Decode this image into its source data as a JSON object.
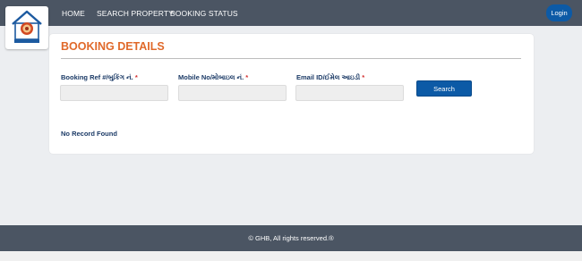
{
  "nav": {
    "home": "HOME",
    "search_property": "SEARCH PROPERTY",
    "booking_status": "BOOKING STATUS",
    "login": "Login"
  },
  "logo": {
    "icon": "house-emblem-icon"
  },
  "booking": {
    "title": "BOOKING DETAILS",
    "ref_label": "Booking Ref #/બુકિંગ નં.",
    "mobile_label": "Mobile No/મોબાઇલ નં.",
    "email_label": "Email ID/ઈમેલ આઇડી",
    "required_mark": "*",
    "ref_value": "",
    "mobile_value": "",
    "email_value": "",
    "search_label": "Search",
    "no_record": "No Record Found"
  },
  "footer": {
    "text": "© GHB, All rights reserved.®"
  },
  "colors": {
    "header_bg": "#4b5563",
    "accent_blue": "#0c5aa6",
    "title_orange": "#e0692a",
    "label_navy": "#1b3a66",
    "required_red": "#d32f2f"
  }
}
